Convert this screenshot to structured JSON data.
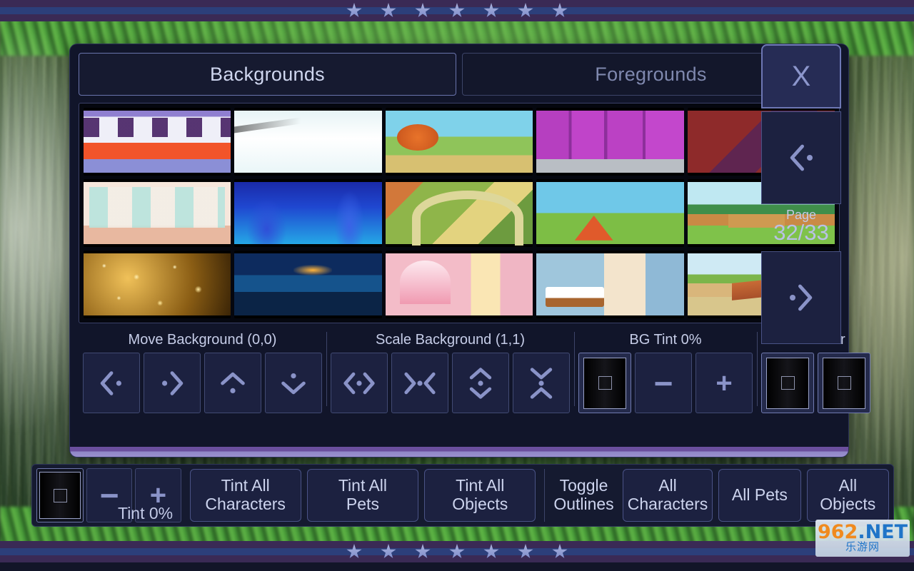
{
  "decor": {
    "star_count": 7,
    "star_color": "#8c96cc",
    "band_purple": "#3a2a55",
    "band_blue": "#2c3f7a"
  },
  "panel": {
    "tabs": [
      {
        "label": "Backgrounds",
        "active": true
      },
      {
        "label": "Foregrounds",
        "active": false
      }
    ],
    "thumbnails": [
      {
        "name": "train-interior"
      },
      {
        "name": "snowy-slope"
      },
      {
        "name": "autumn-meadow"
      },
      {
        "name": "purple-lab-tubes"
      },
      {
        "name": "red-attic-room"
      },
      {
        "name": "dressing-salon"
      },
      {
        "name": "underwater-deep"
      },
      {
        "name": "stone-arch-garden"
      },
      {
        "name": "forest-campsite"
      },
      {
        "name": "riverside-deck"
      },
      {
        "name": "golden-sparkles"
      },
      {
        "name": "night-street"
      },
      {
        "name": "pink-bedroom"
      },
      {
        "name": "blue-bedroom-desk"
      },
      {
        "name": "wooden-bridge-river"
      }
    ],
    "controls": {
      "move": {
        "title": "Move Background (0,0)",
        "buttons": [
          "move-left",
          "move-right",
          "move-up",
          "move-down"
        ]
      },
      "scale": {
        "title": "Scale Background (1,1)",
        "buttons": [
          "scale-width-out",
          "scale-width-in",
          "scale-height-out",
          "scale-height-in"
        ]
      },
      "tint": {
        "title": "BG Tint 0%",
        "minus_label": "−",
        "plus_label": "+"
      },
      "color": {
        "title": "BG Color"
      }
    }
  },
  "sidebar": {
    "close_label": "X",
    "page_label": "Page",
    "page_value": "32/33"
  },
  "toolbar": {
    "tint_label": "Tint 0%",
    "minus_label": "−",
    "plus_label": "+",
    "buttons": [
      {
        "name": "tint-all-characters",
        "line1": "Tint All",
        "line2": "Characters"
      },
      {
        "name": "tint-all-pets",
        "line1": "Tint All",
        "line2": "Pets"
      },
      {
        "name": "tint-all-objects",
        "line1": "Tint All",
        "line2": "Objects"
      }
    ],
    "toggle_outlines": {
      "line1": "Toggle",
      "line2": "Outlines"
    },
    "target_buttons": [
      {
        "name": "all-characters",
        "line1": "All",
        "line2": "Characters"
      },
      {
        "name": "all-pets",
        "line1": "All Pets",
        "line2": ""
      },
      {
        "name": "all-objects",
        "line1": "All",
        "line2": "Objects"
      }
    ]
  },
  "watermark": {
    "num": "962",
    "net": ".NET",
    "cn": "乐游网"
  }
}
